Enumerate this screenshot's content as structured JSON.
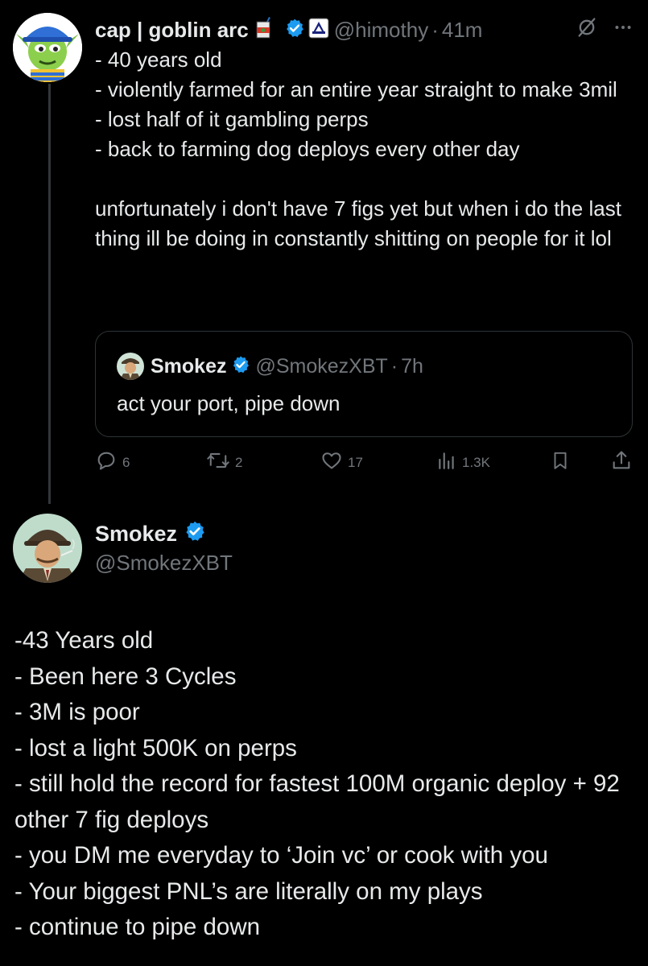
{
  "tweet": {
    "author_name": "cap | goblin arc",
    "author_handle": "@himothy",
    "separator": "·",
    "time": "41m",
    "text": "- 40 years old\n- violently farmed for an entire year straight to make 3mil\n- lost half of it gambling perps\n- back to farming dog deploys every other day\n\nunfortunately i don't have 7 figs yet but when i do the last thing ill be doing in constantly shitting on people for it lol",
    "icons": [
      "juice-box-emoji",
      "verified-badge-icon",
      "affiliate-badge-icon",
      "grok-icon",
      "more-icon"
    ]
  },
  "quote": {
    "author_name": "Smokez",
    "author_handle": "@SmokezXBT",
    "separator": "·",
    "time": "7h",
    "text": "act your port, pipe down"
  },
  "actions": {
    "replies": "6",
    "reposts": "2",
    "likes": "17",
    "views": "1.3K",
    "icons": [
      "reply-icon",
      "repost-icon",
      "like-icon",
      "views-icon",
      "bookmark-icon",
      "share-icon"
    ]
  },
  "reply": {
    "author_name": "Smokez",
    "author_handle": "@SmokezXBT",
    "text": "-43 Years old\n- Been here 3 Cycles\n- 3M is poor\n- lost a light 500K on perps\n- still hold the record for fastest 100M organic deploy + 92 other 7 fig deploys\n- you DM me everyday to ‘Join vc’ or cook with you\n- Your biggest PNL’s are literally on my plays\n- continue to pipe down"
  },
  "colors": {
    "background": "#000000",
    "text": "#e7e9ea",
    "muted": "#71767b",
    "verified": "#1d9bf0",
    "border": "#2f3336"
  }
}
